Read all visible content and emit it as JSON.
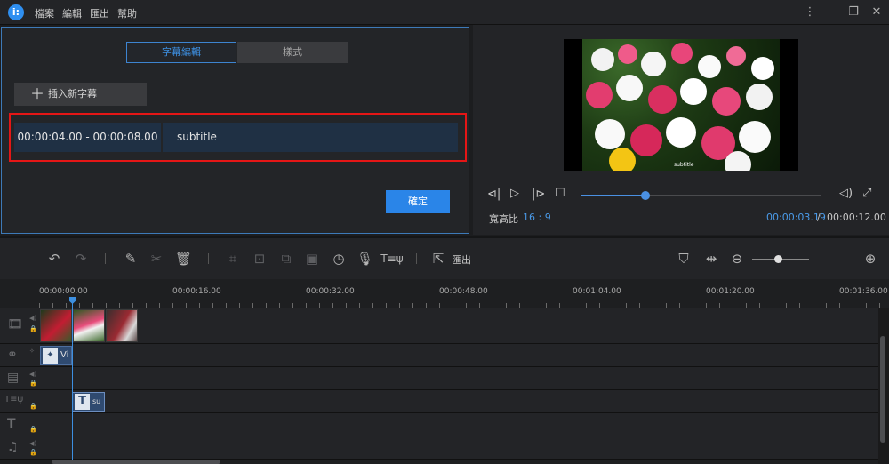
{
  "titlebar": {
    "logo_glyph": "i:",
    "menu": [
      "檔案",
      "編輯",
      "匯出",
      "幫助"
    ]
  },
  "subtitle_panel": {
    "tabs": [
      {
        "label": "字幕編輯",
        "active": true
      },
      {
        "label": "樣式",
        "active": false
      }
    ],
    "add_button_label": "插入新字幕",
    "rows": [
      {
        "time_range": "00:00:04.00 - 00:00:08.00",
        "text": "subtitle"
      }
    ],
    "confirm_label": "確定"
  },
  "preview": {
    "overlay_subtitle": "subtitle",
    "aspect_label": "寬高比",
    "aspect_value": "16 : 9",
    "time_current": "00:00:03.19",
    "time_separator": "/",
    "time_total": "00:00:12.00",
    "progress_fraction": 0.27
  },
  "toolbar": {
    "export_label": "匯出",
    "icons": [
      "undo-icon",
      "redo-icon",
      "pencil-icon",
      "scissors-icon",
      "trash-icon",
      "crop-icon",
      "fit-icon",
      "split-icon",
      "frame-icon",
      "clock-icon",
      "mic-icon",
      "text-speech-icon",
      "export-icon",
      "marker-icon",
      "fit-width-icon",
      "zoom-out-icon",
      "zoom-in-icon"
    ],
    "zoom_fraction": 0.45
  },
  "timeline": {
    "ruler_labels": [
      "00:00:00.00",
      "00:00:16.00",
      "00:00:32.00",
      "00:00:48.00",
      "00:01:04.00",
      "00:01:20.00",
      "00:01:36.00"
    ],
    "tracks": [
      {
        "name": "video",
        "icon": "film-icon"
      },
      {
        "name": "effects",
        "icon": "filter-icon"
      },
      {
        "name": "overlay",
        "icon": "overlay-film-icon"
      },
      {
        "name": "subtitle",
        "icon": "text-speech-icon"
      },
      {
        "name": "text",
        "icon": "text-icon"
      },
      {
        "name": "music",
        "icon": "music-icon"
      }
    ],
    "effect_clip_label": "Vi",
    "subtitle_clip_label": "su"
  },
  "colors": {
    "accent": "#2a85e8",
    "highlight_outline": "#e51616",
    "row_bg": "#1f3044"
  }
}
